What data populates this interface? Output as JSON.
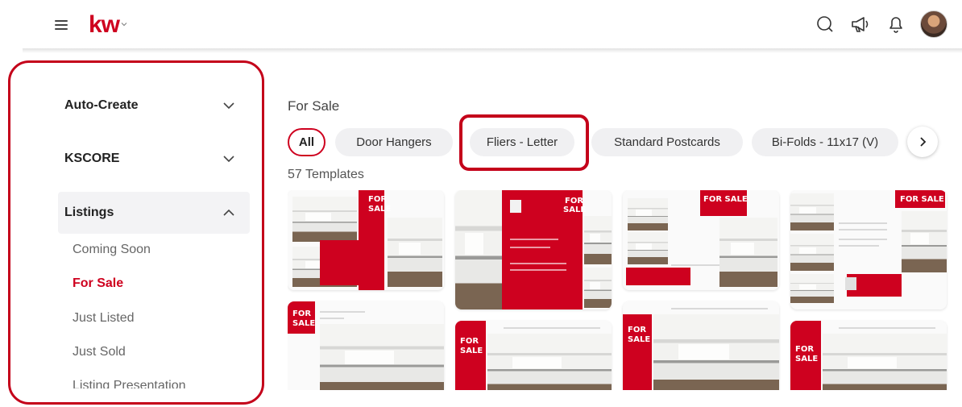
{
  "header": {
    "logo": "kw",
    "icons": [
      "search-icon",
      "megaphone-icon",
      "bell-icon",
      "avatar"
    ]
  },
  "sidebar": {
    "sections": [
      {
        "label": "Auto-Create",
        "expanded": false
      },
      {
        "label": "KSCORE",
        "expanded": false
      },
      {
        "label": "Listings",
        "expanded": true
      }
    ],
    "listings_items": [
      "Coming Soon",
      "For Sale",
      "Just Listed",
      "Just Sold",
      "Listing Presentation"
    ],
    "current_item": "For Sale"
  },
  "main": {
    "title": "For Sale",
    "chips": [
      "All",
      "Door Hangers",
      "Fliers - Letter",
      "Standard Postcards",
      "Bi-Folds - 11x17 (V)"
    ],
    "selected_chip": "All",
    "template_count": "57 Templates",
    "card_text": {
      "for": "FOR",
      "sale": "SALE",
      "for_sale": "FOR SALE"
    }
  },
  "colors": {
    "brand": "#ce011f",
    "highlight": "#c4011a"
  }
}
